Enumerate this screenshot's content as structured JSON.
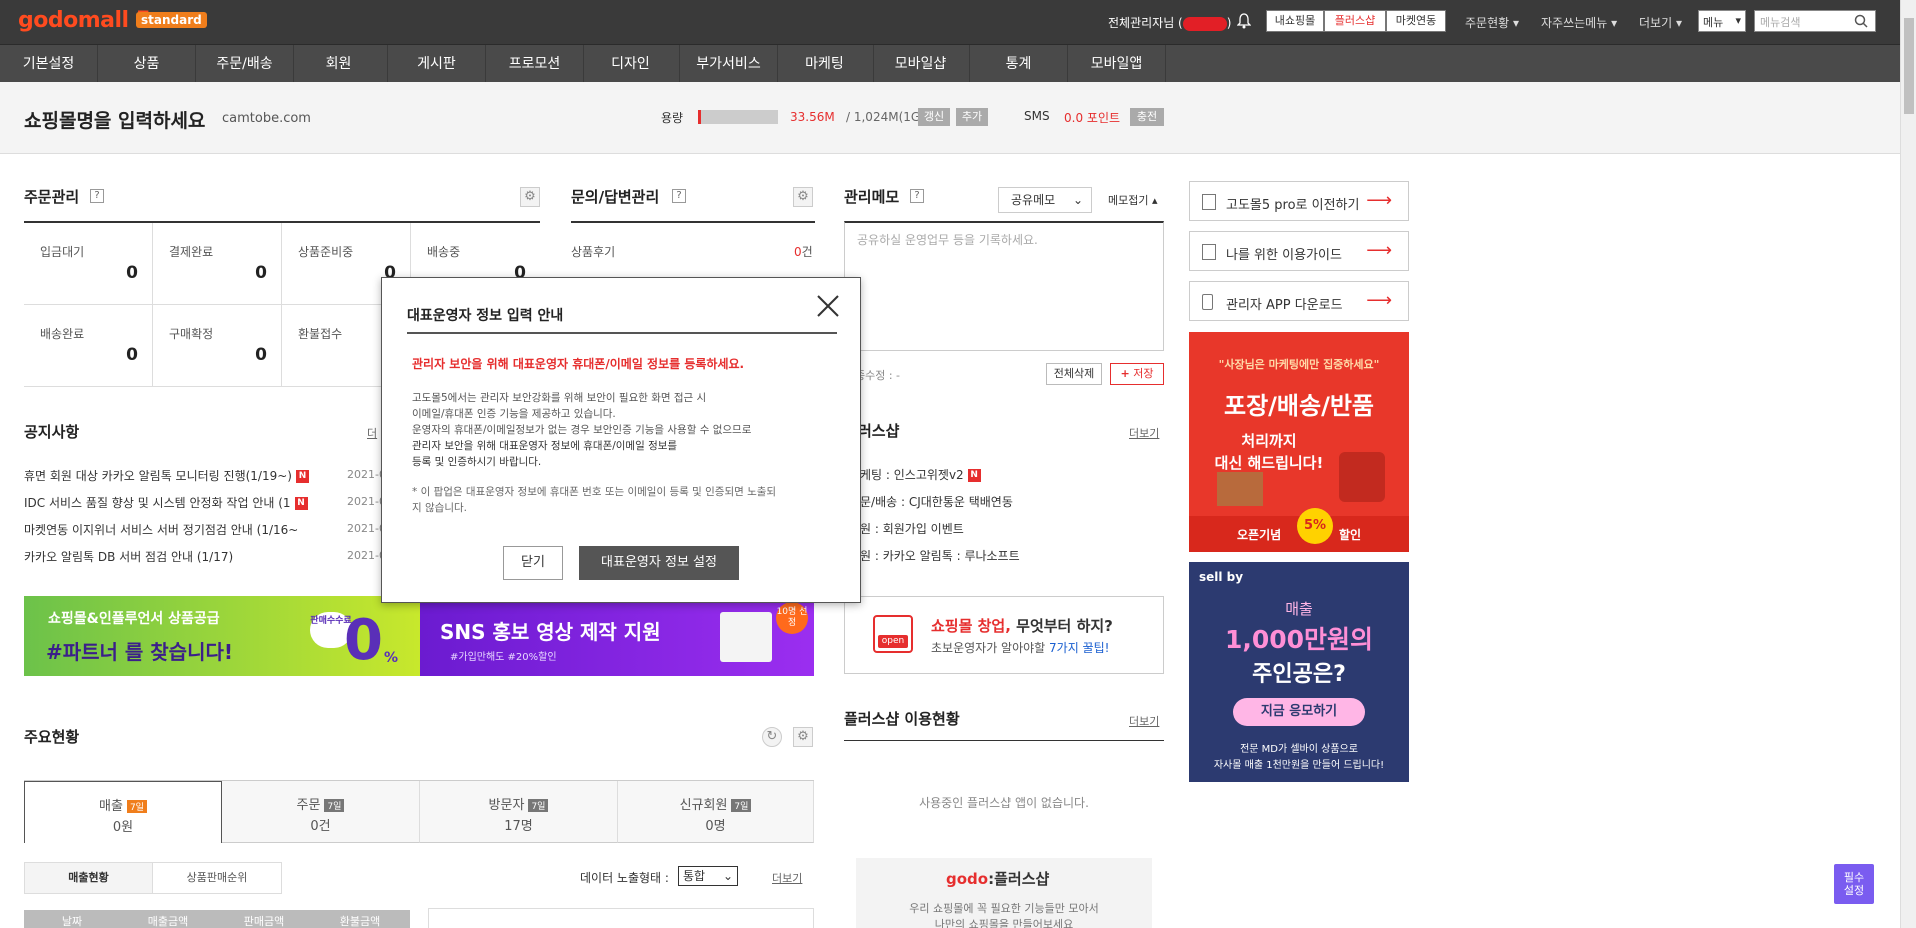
{
  "topbar": {
    "logo": "godomall 5",
    "logo_badge": "standard",
    "admin_name": "전체관리자님 (",
    "admin_suffix": ")",
    "btn_my_shop": "내쇼핑몰",
    "btn_plus_shop": "플러스샵",
    "btn_market": "마켓연동",
    "drop_order": "주문현황",
    "drop_fav": "자주쓰는메뉴",
    "drop_view": "더보기",
    "menu_select": "메뉴",
    "search_placeholder": "메뉴검색"
  },
  "nav": [
    "기본설정",
    "상품",
    "주문/배송",
    "회원",
    "게시판",
    "프로모션",
    "디자인",
    "부가서비스",
    "마케팅",
    "모바일샵",
    "통계",
    "모바일앱"
  ],
  "header": {
    "shop_title": "쇼핑몰명을 입력하세요",
    "shop_domain": "camtobe.com",
    "capacity_label": "용량",
    "capacity_used": "33.56M",
    "capacity_total": "/ 1,024M(1G)",
    "capacity_fraction": 0.033,
    "btn_renew": "갱신",
    "btn_add": "추가",
    "sms_label": "SMS",
    "sms_value": "0.0 포인트",
    "btn_charge": "충전"
  },
  "order": {
    "title": "주문관리",
    "cells": [
      {
        "label": "입금대기",
        "value": "0"
      },
      {
        "label": "결제완료",
        "value": "0"
      },
      {
        "label": "상품준비중",
        "value": "0"
      },
      {
        "label": "배송중",
        "value": "0"
      },
      {
        "label": "배송완료",
        "value": "0"
      },
      {
        "label": "구매확정",
        "value": "0"
      },
      {
        "label": "환불접수",
        "value": ""
      }
    ]
  },
  "inquiry": {
    "title": "문의/답변관리",
    "row_label": "상품후기",
    "row_value": "0",
    "row_unit": "건"
  },
  "memo": {
    "title": "관리메모",
    "select": "공유메모",
    "fold": "메모접기",
    "placeholder": "공유하실 운영업무 등을 기록하세요.",
    "modified": "종수정 : -",
    "btn_delete_all": "전체삭제",
    "btn_save": "저장"
  },
  "right": {
    "items": [
      {
        "label": "고도몰5 pro로 이전하기"
      },
      {
        "label": "나를 위한 이용가이드"
      },
      {
        "label": "관리자 APP 다운로드"
      }
    ],
    "ad1": {
      "line1": "\"사장님은 마케팅에만 집중하세요\"",
      "line2": "포장/배송/반품",
      "line3": "처리까지",
      "line4": "대신 해드립니다!",
      "line5": "오픈기념",
      "line6": "5%",
      "line7": "할인"
    },
    "ad2": {
      "brand": "sell by",
      "line1": "매출",
      "line2": "1,000만원의",
      "line3": "주인공은?",
      "btn": "지금 응모하기",
      "foot1": "전문 MD가 셀바이 상품으로",
      "foot2": "자사몰 매출 1천만원을 만들어 드립니다!"
    }
  },
  "notice": {
    "title": "공지사항",
    "more": "더",
    "items": [
      {
        "text": "휴면 회원 대상 카카오 알림톡 모니터링 진행(1/19~)",
        "date": "2021-0"
      },
      {
        "text": "IDC 서비스 품질 향상 및 시스템 안정화 작업 안내 (1",
        "date": "2021-0"
      },
      {
        "text": "마켓연동 이지위너 서비스 서버 정기점검 안내 (1/16~",
        "date": "2021-0"
      },
      {
        "text": "카카오 알림톡 DB 서버 점검 안내 (1/17)",
        "date": "2021-0"
      }
    ]
  },
  "plusshop": {
    "title": "러스샵",
    "more": "더보기",
    "items": [
      "케팅 : 인스고위젯v2",
      "문/배송 : CJ대한통운 택배연동",
      "원 : 회원가입 이벤트",
      "원 : 카카오 알림톡 : 루나소프트"
    ],
    "startup_title_1": "쇼핑몰 창업,",
    "startup_title_2": " 무엇부터 하지?",
    "startup_sub_1": "초보운영자가 알아야할 ",
    "startup_sub_2": "7가지 꿀팁!",
    "startup_icon": "open",
    "status_title": "플러스샵 이용현황",
    "status_more": "더보기",
    "status_empty": "사용중인 플러스샵 앱이 없습니다.",
    "promo_logo_1": "godo",
    "promo_logo_2": ":플러스샵",
    "promo_text_1": "우리 쇼핑몰에 꼭 필요한 기능들만 모아서",
    "promo_text_2": "나만의 쇼핑몰을 만들어보세요"
  },
  "banners": {
    "a_line1": "쇼핑몰&인플루언서 상품공급",
    "a_line2": "#파트너 를 찾습니다!",
    "a_badge": "판매수수료",
    "a_zero": "0",
    "a_pct": "%",
    "b_line1": "SNS 홍보 영상 제작 지원",
    "b_line2": "#가입만해도 #20%할인",
    "b_badge": "10명 선정"
  },
  "stats": {
    "title": "주요현황",
    "tabs": [
      {
        "label": "매출",
        "badge": "7일",
        "value": "0원"
      },
      {
        "label": "주문",
        "badge": "7일",
        "value": "0건"
      },
      {
        "label": "방문자",
        "badge": "7일",
        "value": "17명"
      },
      {
        "label": "신규회원",
        "badge": "7일",
        "value": "0명"
      }
    ],
    "sub_tabs": [
      "매출현황",
      "상품판매순위"
    ],
    "data_label": "데이터 노출형태 :",
    "data_select": "통합",
    "more": "더보기",
    "table_headers": [
      "날짜",
      "매출금액",
      "판매금액",
      "환불금액"
    ]
  },
  "float_btn": "필수\n설정",
  "modal": {
    "title": "대표운영자 정보 입력 안내",
    "alert": "관리자 보안을 위해 대표운영자 휴대폰/이메일 정보를 등록하세요.",
    "lines": [
      "고도몰5에서는 관리자 보안강화를 위해 보안이 필요한 화면 접근 시",
      "이메일/휴대폰 인증 기능을 제공하고 있습니다.",
      "운영자의 휴대폰/이메일정보가 없는 경우 보안인증 기능을 사용할 수 없으므로",
      "관리자 보안을 위해 대표운영자 정보에 휴대폰/이메일 정보를",
      "등록 및 인증하시기 바랍니다."
    ],
    "note_1": "* 이 팝업은 대표운영자 정보에 휴대폰 번호 또는 이메일이 등록 및 인증되면 노출되",
    "note_2": "지 않습니다.",
    "btn_close": "닫기",
    "btn_set": "대표운영자 정보 설정"
  }
}
